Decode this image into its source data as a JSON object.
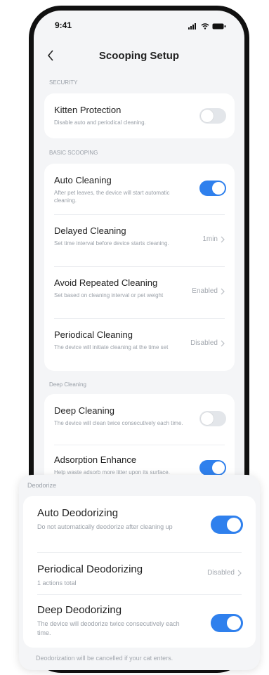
{
  "status": {
    "time": "9:41"
  },
  "header": {
    "title": "Scooping Setup"
  },
  "sections": {
    "security": "SECURITY",
    "basic": "BASIC SCOOPING",
    "deep": "Deep Cleaning"
  },
  "security": {
    "kitten": {
      "title": "Kitten Protection",
      "subtitle": "Disable auto and periodical cleaning.",
      "enabled": false
    }
  },
  "basic": {
    "auto": {
      "title": "Auto Cleaning",
      "subtitle": "After pet leaves, the device will start automatic cleaning.",
      "enabled": true
    },
    "delayed": {
      "title": "Delayed Cleaning",
      "subtitle": "Set time interval before device starts cleaning.",
      "value": "1min"
    },
    "avoid": {
      "title": "Avoid Repeated Cleaning",
      "subtitle": "Set based on cleaning interval or pet weight",
      "value": "Enabled"
    },
    "periodical": {
      "title": "Periodical Cleaning",
      "subtitle": "The device will initiate cleaning at the time set",
      "value": "Disabled"
    }
  },
  "deep": {
    "deep_cleaning": {
      "title": "Deep Cleaning",
      "subtitle": "The device will clean twice consecutively each time.",
      "enabled": false
    },
    "adsorption": {
      "title": "Adsorption Enhance",
      "subtitle": "Help waste adsorb more litter upon its surface.",
      "enabled": true
    }
  },
  "deodorize": {
    "section": "Deodorize",
    "auto": {
      "title": "Auto Deodorizing",
      "subtitle": "Do not automatically deodorize after cleaning up",
      "enabled": true
    },
    "periodical": {
      "title": "Periodical Deodorizing",
      "subtitle": "1 actions total",
      "value": "Disabled"
    },
    "deep": {
      "title": "Deep Deodorizing",
      "subtitle": "The device will deodorize twice consecutively each time.",
      "enabled": true
    },
    "footer": "Deodorization will be cancelled if your cat enters."
  },
  "colors": {
    "accent": "#2f80ed",
    "background": "#f4f5f7",
    "card": "#ffffff",
    "muted": "#9aa0a8"
  }
}
